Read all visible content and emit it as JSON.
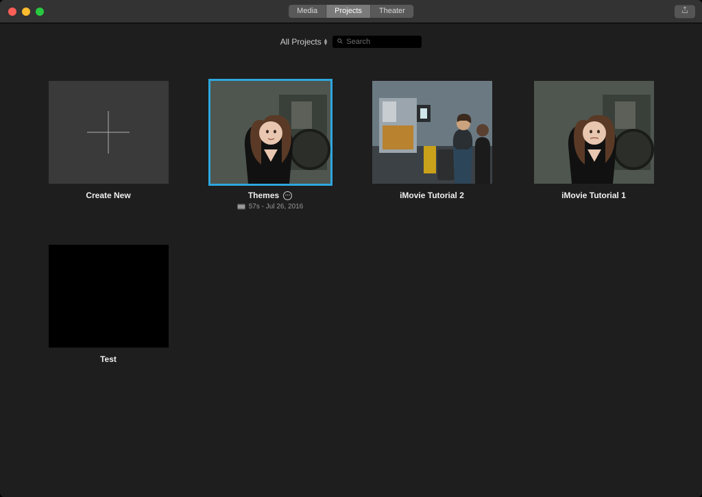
{
  "titlebar": {
    "tabs": [
      "Media",
      "Projects",
      "Theater"
    ],
    "active_tab_index": 1
  },
  "filterbar": {
    "dropdown_label": "All Projects",
    "search_placeholder": "Search",
    "search_value": ""
  },
  "projects": [
    {
      "kind": "create",
      "title": "Create New"
    },
    {
      "kind": "project",
      "title": "Themes",
      "selected": true,
      "meta": "57s - Jul 26, 2016",
      "thumb": "woman_workshop"
    },
    {
      "kind": "project",
      "title": "iMovie Tutorial 2",
      "thumb": "workshop_scene"
    },
    {
      "kind": "project",
      "title": "iMovie Tutorial 1",
      "thumb": "woman_workshop"
    },
    {
      "kind": "project",
      "title": "Test",
      "thumb": "black"
    }
  ]
}
